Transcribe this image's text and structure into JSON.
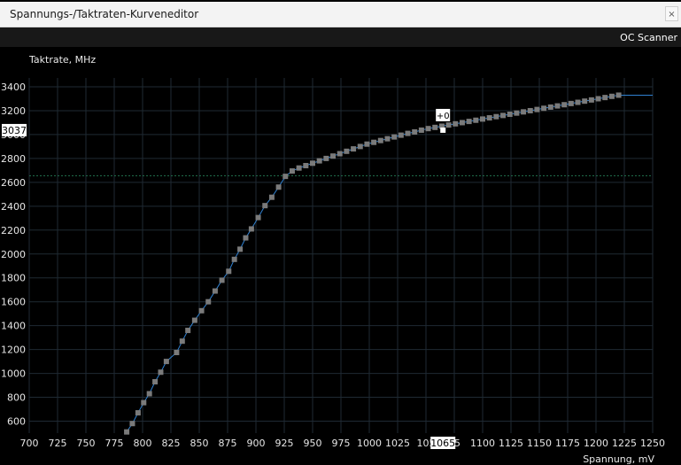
{
  "window": {
    "title": "Spannungs-/Taktraten-Kurveneditor",
    "close_glyph": "×"
  },
  "toolbar": {
    "oc_scanner": "OC Scanner"
  },
  "graph": {
    "y_axis_label": "Taktrate, MHz",
    "x_axis_label": "Spannung, mV",
    "current_frequency": "3037",
    "current_voltage": "1065",
    "point_offset": "+0",
    "colors": {
      "background": "#000000",
      "grid": "#1f2a33",
      "line": "#2f80d0",
      "marker": "#7a7a7a",
      "selected_marker": "#ffffff",
      "limit_line": "#1f6b4a"
    }
  },
  "chart_data": {
    "type": "line",
    "xlabel": "Spannung, mV",
    "ylabel": "Taktrate, MHz",
    "xlim": [
      700,
      1250
    ],
    "ylim": [
      500,
      3400
    ],
    "x_ticks": [
      700,
      725,
      750,
      775,
      800,
      825,
      850,
      875,
      900,
      925,
      950,
      975,
      1000,
      1025,
      1050,
      1075,
      1100,
      1125,
      1150,
      1175,
      1200,
      1225,
      1250
    ],
    "x_tick_labels": [
      "700",
      "725",
      "750",
      "775",
      "800",
      "825",
      "850",
      "875",
      "900",
      "925",
      "950",
      "975",
      "1000",
      "1025",
      "105",
      "75",
      "1100",
      "1125",
      "1150",
      "1175",
      "1200",
      "1225",
      "1250"
    ],
    "y_ticks": [
      600,
      800,
      1000,
      1200,
      1400,
      1600,
      1800,
      2000,
      2200,
      2400,
      2600,
      2800,
      3000,
      3200,
      3400
    ],
    "limit_line_value": 2655,
    "selected_point": {
      "x": 1065,
      "y": 3037
    },
    "series": [
      {
        "points": [
          [
            786,
            510
          ],
          [
            791,
            580
          ],
          [
            796,
            670
          ],
          [
            801,
            755
          ],
          [
            806,
            830
          ],
          [
            811,
            930
          ],
          [
            816,
            1010
          ],
          [
            821,
            1100
          ],
          [
            830,
            1175
          ],
          [
            835,
            1270
          ],
          [
            840,
            1360
          ],
          [
            846,
            1445
          ],
          [
            852,
            1525
          ],
          [
            858,
            1600
          ],
          [
            864,
            1690
          ],
          [
            870,
            1780
          ],
          [
            876,
            1855
          ],
          [
            881,
            1955
          ],
          [
            886,
            2040
          ],
          [
            891,
            2135
          ],
          [
            896,
            2210
          ],
          [
            902,
            2305
          ],
          [
            908,
            2405
          ],
          [
            914,
            2475
          ],
          [
            920,
            2560
          ],
          [
            926,
            2650
          ],
          [
            932,
            2695
          ],
          [
            938,
            2720
          ],
          [
            944,
            2740
          ],
          [
            950,
            2760
          ],
          [
            956,
            2780
          ],
          [
            962,
            2800
          ],
          [
            968,
            2820
          ],
          [
            974,
            2840
          ],
          [
            980,
            2860
          ],
          [
            986,
            2880
          ],
          [
            992,
            2900
          ],
          [
            998,
            2920
          ],
          [
            1004,
            2935
          ],
          [
            1010,
            2950
          ],
          [
            1016,
            2965
          ],
          [
            1022,
            2980
          ],
          [
            1028,
            2995
          ],
          [
            1034,
            3010
          ],
          [
            1040,
            3022
          ],
          [
            1046,
            3037
          ],
          [
            1052,
            3050
          ],
          [
            1058,
            3060
          ],
          [
            1064,
            3070
          ],
          [
            1070,
            3080
          ],
          [
            1076,
            3090
          ],
          [
            1082,
            3100
          ],
          [
            1088,
            3110
          ],
          [
            1094,
            3120
          ],
          [
            1100,
            3130
          ],
          [
            1106,
            3140
          ],
          [
            1112,
            3150
          ],
          [
            1118,
            3160
          ],
          [
            1124,
            3170
          ],
          [
            1130,
            3180
          ],
          [
            1136,
            3190
          ],
          [
            1142,
            3200
          ],
          [
            1148,
            3210
          ],
          [
            1154,
            3220
          ],
          [
            1160,
            3230
          ],
          [
            1166,
            3240
          ],
          [
            1172,
            3250
          ],
          [
            1178,
            3260
          ],
          [
            1184,
            3270
          ],
          [
            1190,
            3280
          ],
          [
            1196,
            3290
          ],
          [
            1202,
            3300
          ],
          [
            1208,
            3310
          ],
          [
            1214,
            3320
          ],
          [
            1220,
            3330
          ]
        ]
      }
    ]
  }
}
